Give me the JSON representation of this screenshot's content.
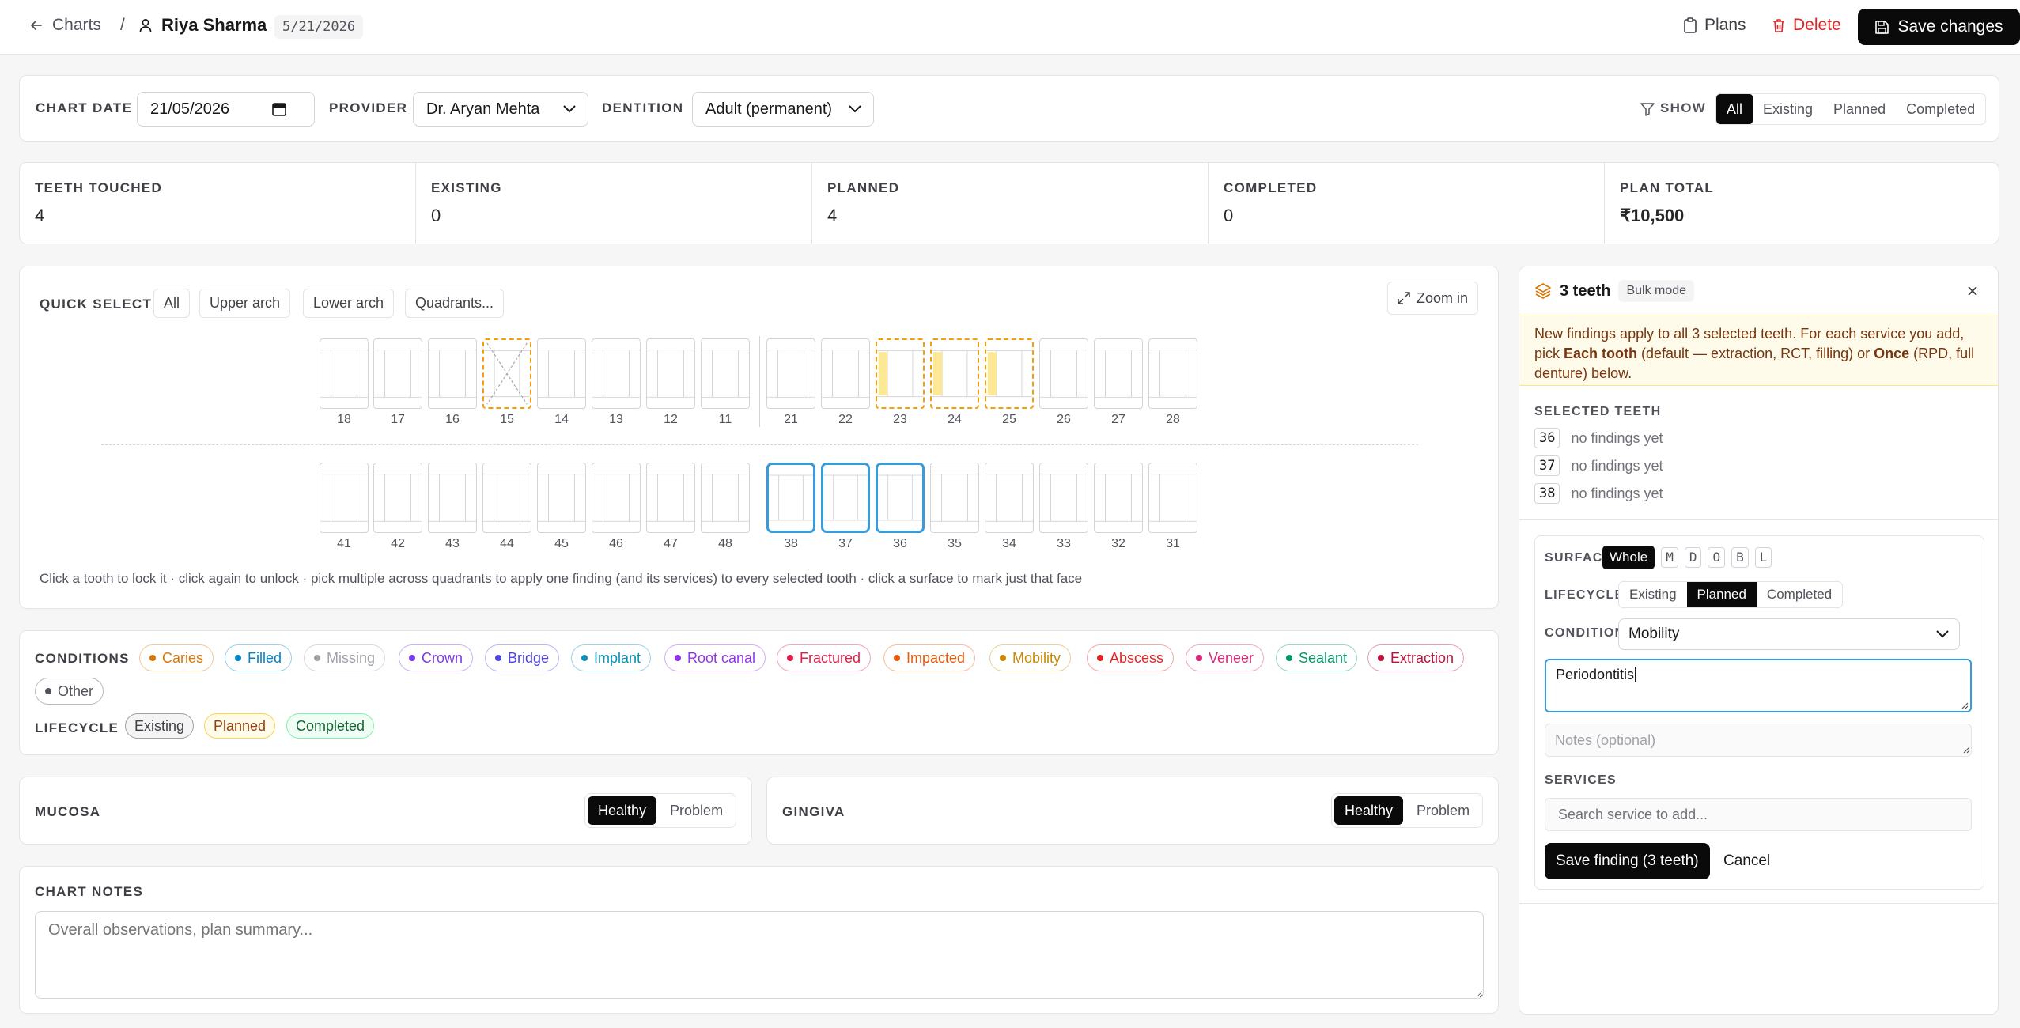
{
  "topbar": {
    "back_label": "Charts",
    "separator": "/",
    "patient_name": "Riya Sharma",
    "date": "5/21/2026",
    "plans_label": "Plans",
    "delete_label": "Delete",
    "save_label": "Save changes"
  },
  "filters": {
    "chart_date_label": "CHART DATE",
    "chart_date_value": "21/05/2026",
    "provider_label": "PROVIDER",
    "provider_value": "Dr. Aryan Mehta",
    "dentition_label": "DENTITION",
    "dentition_value": "Adult (permanent)",
    "show_label": "SHOW",
    "show_options": [
      "All",
      "Existing",
      "Planned",
      "Completed"
    ],
    "show_selected": "All"
  },
  "stats": [
    {
      "label": "TEETH TOUCHED",
      "value": "4"
    },
    {
      "label": "EXISTING",
      "value": "0"
    },
    {
      "label": "PLANNED",
      "value": "4"
    },
    {
      "label": "COMPLETED",
      "value": "0"
    },
    {
      "label": "PLAN TOTAL",
      "value": "₹10,500"
    }
  ],
  "chart": {
    "quick_select_label": "QUICK SELECT",
    "quick_buttons": [
      "All",
      "Upper arch",
      "Lower arch",
      "Quadrants..."
    ],
    "zoom_label": "Zoom in",
    "upper_teeth": [
      "18",
      "17",
      "16",
      "15",
      "14",
      "13",
      "12",
      "11",
      "21",
      "22",
      "23",
      "24",
      "25",
      "26",
      "27",
      "28"
    ],
    "lower_teeth": [
      "41",
      "42",
      "43",
      "44",
      "45",
      "46",
      "47",
      "48",
      "38",
      "37",
      "36",
      "35",
      "34",
      "33",
      "32",
      "31"
    ],
    "missing_planned": [
      "15"
    ],
    "filled_planned": [
      "23",
      "24",
      "25"
    ],
    "selected": [
      "38",
      "37",
      "36"
    ],
    "help_text": "Click a tooth to lock it · click again to unlock · pick multiple across quadrants to apply one finding (and its services) to every selected tooth · click a surface to mark just that face"
  },
  "legend": {
    "conditions_label": "CONDITIONS",
    "conditions": [
      {
        "name": "Caries",
        "color": "#d97706"
      },
      {
        "name": "Filled",
        "color": "#0284c7"
      },
      {
        "name": "Missing",
        "color": "#a1a1aa"
      },
      {
        "name": "Crown",
        "color": "#7c3aed"
      },
      {
        "name": "Bridge",
        "color": "#4f46e5"
      },
      {
        "name": "Implant",
        "color": "#0891b2"
      },
      {
        "name": "Root canal",
        "color": "#9333ea"
      },
      {
        "name": "Fractured",
        "color": "#e11d48"
      },
      {
        "name": "Impacted",
        "color": "#ea580c"
      },
      {
        "name": "Mobility",
        "color": "#ca8a04"
      },
      {
        "name": "Abscess",
        "color": "#dc2626"
      },
      {
        "name": "Veneer",
        "color": "#db2777"
      },
      {
        "name": "Sealant",
        "color": "#059669"
      },
      {
        "name": "Extraction",
        "color": "#be123c"
      },
      {
        "name": "Other",
        "color": "#52525b"
      }
    ],
    "lifecycle_label": "LIFECYCLE",
    "lifecycle": [
      "Existing",
      "Planned",
      "Completed"
    ]
  },
  "mucosa": {
    "label": "MUCOSA",
    "options": [
      "Healthy",
      "Problem"
    ],
    "selected": "Healthy"
  },
  "gingiva": {
    "label": "GINGIVA",
    "options": [
      "Healthy",
      "Problem"
    ],
    "selected": "Healthy"
  },
  "notes": {
    "label": "CHART NOTES",
    "placeholder": "Overall observations, plan summary..."
  },
  "panel": {
    "title": "3 teeth",
    "badge": "Bulk mode",
    "info_1": "New findings apply to all 3 selected teeth. For each service you add, pick ",
    "info_each": "Each tooth",
    "info_2": " (default — extraction, RCT, filling) or ",
    "info_once": "Once",
    "info_3": " (RPD, full denture) below.",
    "selected_label": "SELECTED TEETH",
    "selected_teeth": [
      {
        "num": "36",
        "status": "no findings yet"
      },
      {
        "num": "37",
        "status": "no findings yet"
      },
      {
        "num": "38",
        "status": "no findings yet"
      }
    ],
    "surface_label": "SURFACE",
    "surfaces": [
      "Whole",
      "M",
      "D",
      "O",
      "B",
      "L"
    ],
    "lifecycle_label": "LIFECYCLE",
    "lifecycle": [
      "Existing",
      "Planned",
      "Completed"
    ],
    "lifecycle_selected": "Planned",
    "condition_label": "CONDITION",
    "condition_value": "Mobility",
    "detail_value": "Periodontitis",
    "notes_placeholder": "Notes (optional)",
    "services_label": "SERVICES",
    "services_placeholder": "Search service to add...",
    "save_label": "Save finding (3 teeth)",
    "cancel_label": "Cancel"
  }
}
